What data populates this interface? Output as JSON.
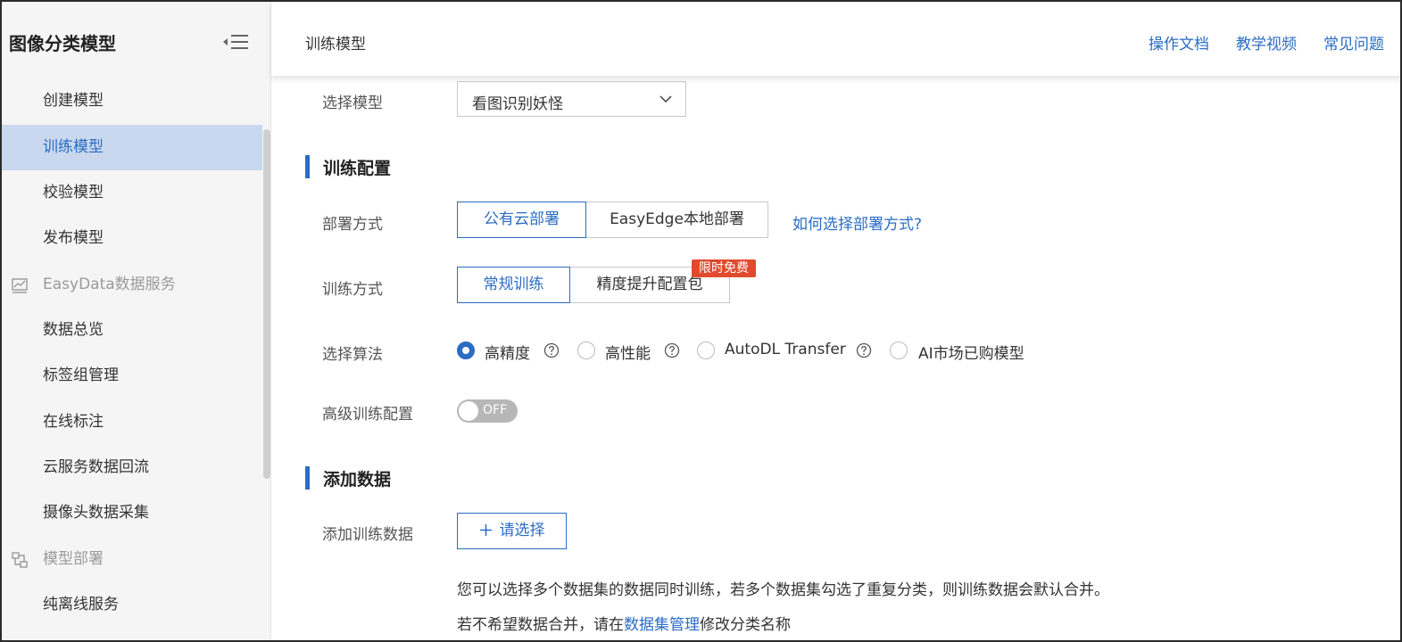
{
  "sidebar": {
    "title": "图像分类模型",
    "items": [
      {
        "label": "创建模型"
      },
      {
        "label": "训练模型"
      },
      {
        "label": "校验模型"
      },
      {
        "label": "发布模型"
      },
      {
        "label": "EasyData数据服务"
      },
      {
        "label": "数据总览"
      },
      {
        "label": "标签组管理"
      },
      {
        "label": "在线标注"
      },
      {
        "label": "云服务数据回流"
      },
      {
        "label": "摄像头数据采集"
      },
      {
        "label": "模型部署"
      },
      {
        "label": "纯离线服务"
      }
    ]
  },
  "header": {
    "title": "训练模型",
    "links": [
      "操作文档",
      "教学视频",
      "常见问题"
    ]
  },
  "form": {
    "select_model_label": "选择模型",
    "select_model_value": "看图识别妖怪",
    "section_train": "训练配置",
    "deploy_label": "部署方式",
    "deploy_options": [
      "公有云部署",
      "EasyEdge本地部署"
    ],
    "deploy_help": "如何选择部署方式?",
    "train_mode_label": "训练方式",
    "train_mode_options": [
      "常规训练",
      "精度提升配置包"
    ],
    "promo_badge": "限时免费",
    "algo_label": "选择算法",
    "algo_options": [
      "高精度",
      "高性能",
      "AutoDL Transfer",
      "AI市场已购模型"
    ],
    "advanced_label": "高级训练配置",
    "toggle_text": "OFF",
    "section_data": "添加数据",
    "add_data_label": "添加训练数据",
    "add_button": "请选择",
    "hint1": "您可以选择多个数据集的数据同时训练，若多个数据集勾选了重复分类，则训练数据会默认合并。",
    "hint2_prefix": "若不希望数据合并，请在",
    "hint2_link": "数据集管理",
    "hint2_suffix": "修改分类名称"
  },
  "colors": {
    "accent": "#2b6cc4",
    "active_bg": "#c9d8ee",
    "badge": "#e24a2e"
  },
  "icons": [
    "collapse-menu-icon",
    "chart-icon",
    "deploy-icon",
    "chevron-down-icon",
    "help-icon",
    "plus-icon"
  ]
}
